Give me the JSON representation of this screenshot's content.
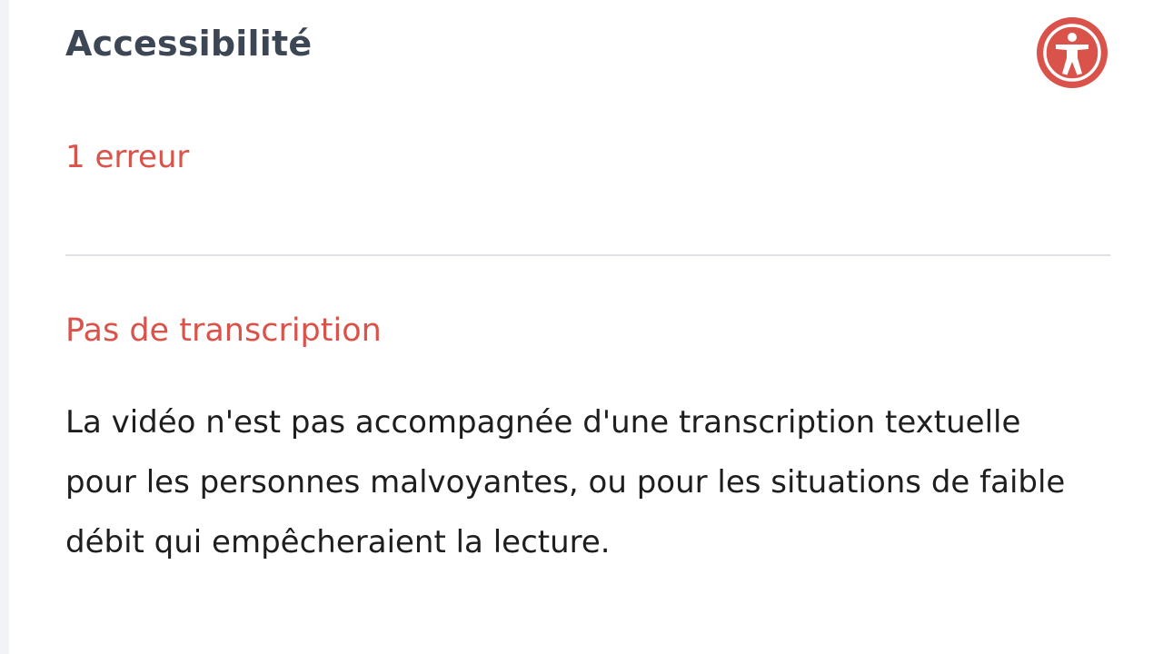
{
  "panel": {
    "title": "Accessibilité",
    "badge_icon": "accessibility-icon",
    "error_count": "1 erreur"
  },
  "issues": [
    {
      "title": "Pas de transcription",
      "description": "La vidéo n'est pas accompagnée d'une transcription textuelle pour les personnes malvoyantes, ou pour les situations de faible débit qui empêcheraient la lecture."
    }
  ],
  "colors": {
    "accent_red": "#d9534a",
    "title_gray": "#3d4654",
    "body_text": "#1e1e1e",
    "divider": "#dfe1e5"
  }
}
